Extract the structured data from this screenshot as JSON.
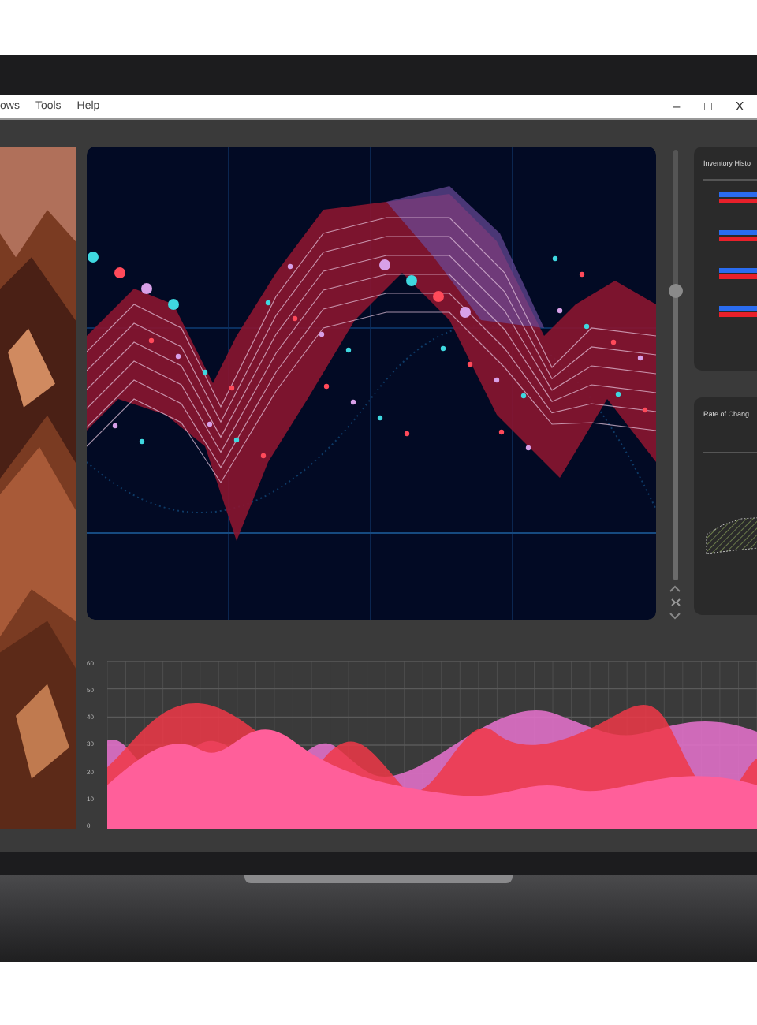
{
  "window": {
    "menu": [
      "ows",
      "Tools",
      "Help"
    ],
    "controls": [
      "–",
      "□",
      "X"
    ]
  },
  "zoom_slider": {
    "level": 0.67
  },
  "cards": [
    {
      "title": "Inventory Histo",
      "kind": "bars"
    },
    {
      "title": "Rate of Chang",
      "kind": "area"
    }
  ],
  "bottom_chart": {
    "y_ticks": [
      "60",
      "50",
      "40",
      "30",
      "20",
      "10",
      "0"
    ]
  }
}
